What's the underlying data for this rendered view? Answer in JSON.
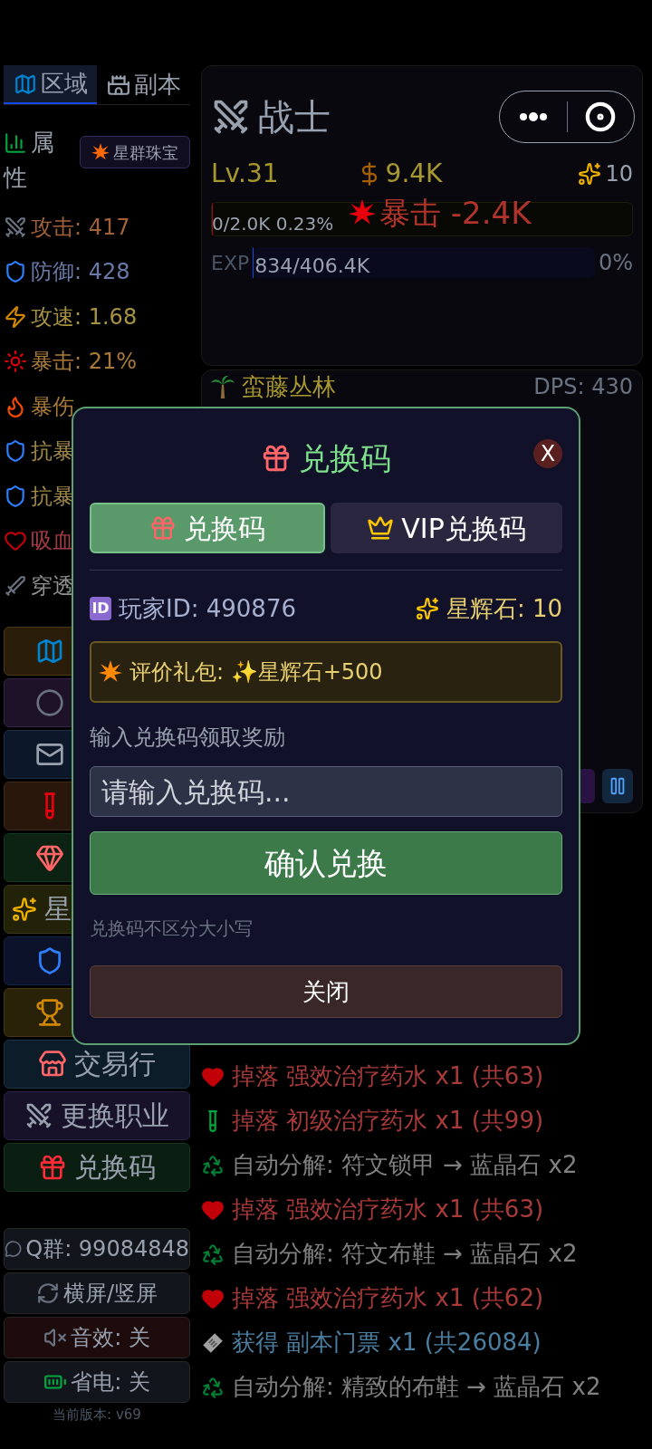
{
  "left_tabs": [
    {
      "label": "区域",
      "kind": "map",
      "selected": true
    },
    {
      "label": "副本",
      "kind": "castle",
      "selected": false
    }
  ],
  "attributes": {
    "title_top": "属",
    "title_bottom": "性",
    "jewel_button": "星群珠宝",
    "stats": [
      {
        "kind": "attack",
        "text": "攻击: 417",
        "color": "#a0603a"
      },
      {
        "kind": "defense",
        "text": "防御: 428",
        "color": "#6a7aa8"
      },
      {
        "kind": "speed",
        "text": "攻速: 1.68",
        "color": "#a89440"
      },
      {
        "kind": "crit",
        "text": "暴击: 21%",
        "color": "#a87a3a"
      },
      {
        "kind": "critdmg",
        "text": "暴伤",
        "color": "#a87a3a"
      },
      {
        "kind": "defense",
        "text": "抗暴",
        "color": "#a08848"
      },
      {
        "kind": "defense",
        "text": "抗暴",
        "color": "#a08848"
      },
      {
        "kind": "lifesteal",
        "text": "吸血",
        "color": "#a03a44"
      },
      {
        "kind": "pierce",
        "text": "穿透",
        "color": "#909090"
      }
    ]
  },
  "nav_menu": [
    {
      "kind": "map"
    },
    {
      "kind": "orb"
    },
    {
      "kind": "mail"
    },
    {
      "kind": "potion"
    },
    {
      "kind": "gem"
    },
    {
      "kind": "star",
      "label": "星"
    },
    {
      "kind": "shield"
    },
    {
      "kind": "trophy"
    },
    {
      "kind": "market",
      "label": "交易行"
    },
    {
      "kind": "swords",
      "label": "更换职业"
    },
    {
      "kind": "gift",
      "label": "兑换码"
    }
  ],
  "settings_menu": [
    {
      "kind": "chat",
      "label": "Q群: 99084848"
    },
    {
      "kind": "rotate",
      "label": "横屏/竖屏"
    },
    {
      "kind": "sound",
      "label": "音效: 关",
      "on": false
    },
    {
      "kind": "battery",
      "label": "省电: 关",
      "on": false
    }
  ],
  "version": "当前版本: v69",
  "hero": {
    "class_name": "战士",
    "level_text": "Lv.31",
    "gold": "9.4K",
    "sparkle_count": "10",
    "damage_popup": "暴击 -2.4K",
    "hp": {
      "text": "0/2.0K 0.23%",
      "level": 0.0023
    },
    "exp": {
      "label": "EXP",
      "text": "834/406.4K",
      "percent": "0%",
      "level": 0.002
    }
  },
  "zone": {
    "name": "蛮藤丛林",
    "dps": "DPS: 430"
  },
  "log": [
    {
      "kind": "drop",
      "text": "掉落 强效治疗药水 x1 (共63)"
    },
    {
      "kind": "droptube",
      "text": "掉落 初级治疗药水 x1 (共99)"
    },
    {
      "kind": "decompose",
      "text": "自动分解: 符文锁甲 → 蓝晶石 x2"
    },
    {
      "kind": "drop",
      "text": "掉落 强效治疗药水 x1 (共63)"
    },
    {
      "kind": "decompose",
      "text": "自动分解: 符文布鞋 → 蓝晶石 x2"
    },
    {
      "kind": "drop",
      "text": "掉落 强效治疗药水 x1 (共62)"
    },
    {
      "kind": "obtain",
      "text": "获得 副本门票 x1 (共26084)"
    },
    {
      "kind": "decompose",
      "text": "自动分解: 精致的布鞋 → 蓝晶石 x2"
    }
  ],
  "modal": {
    "title": "兑换码",
    "close_icon": "X",
    "tabs": [
      {
        "label": "兑换码",
        "kind": "gift",
        "selected": true
      },
      {
        "label": "VIP兑换码",
        "kind": "crown",
        "selected": false
      }
    ],
    "id_badge": "ID",
    "player_id": "玩家ID: 490876",
    "star_stones": "星辉石: 10",
    "promo": "评价礼包: ✨星辉石+500",
    "prompt": "输入兑换码领取奖励",
    "input": {
      "placeholder": "请输入兑换码..."
    },
    "confirm": "确认兑换",
    "note": "兑换码不区分大小写",
    "close": "关闭"
  }
}
